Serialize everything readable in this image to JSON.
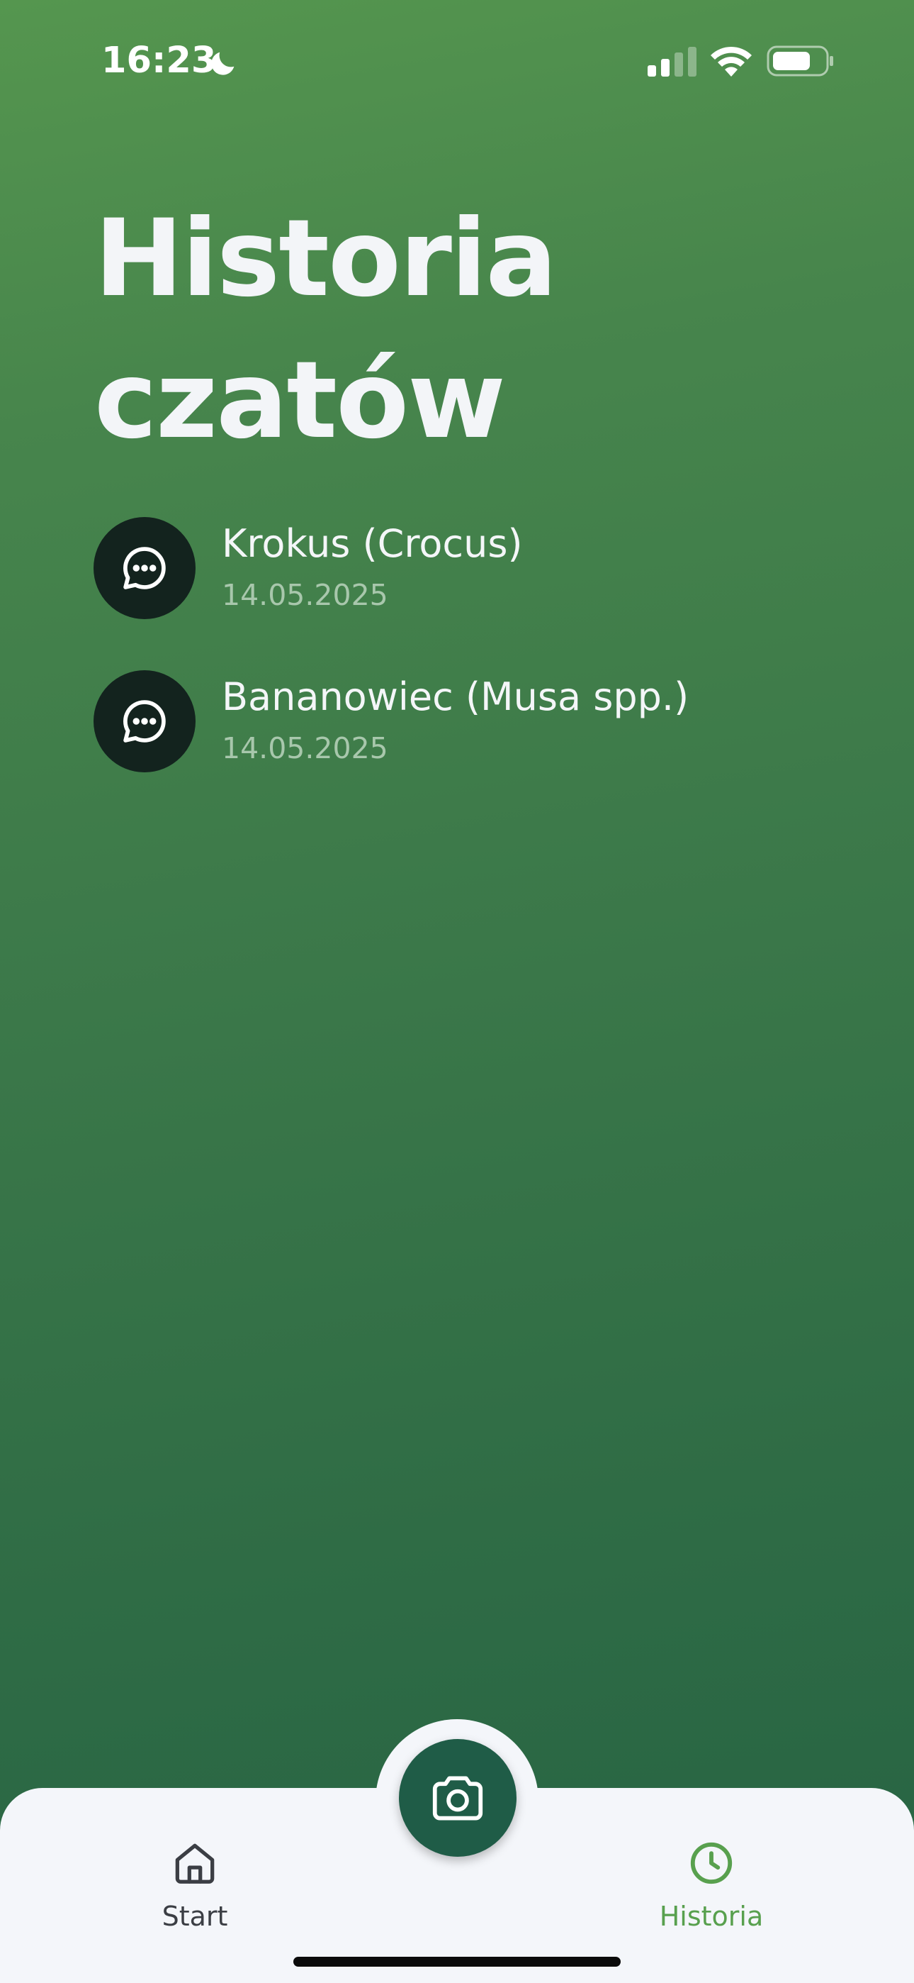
{
  "status_bar": {
    "time": "16:23",
    "icons": [
      "moon-icon",
      "cellular-signal-icon",
      "wifi-icon",
      "battery-icon"
    ]
  },
  "page": {
    "title": "Historia czatów"
  },
  "chats": [
    {
      "title": "Krokus (Crocus)",
      "date": "14.05.2025",
      "icon": "chat-bubble-icon"
    },
    {
      "title": "Bananowiec (Musa spp.)",
      "date": "14.05.2025",
      "icon": "chat-bubble-icon"
    }
  ],
  "tab_bar": {
    "start_label": "Start",
    "history_label": "Historia",
    "camera_icon": "camera-icon",
    "active_tab": "Historia"
  },
  "colors": {
    "background_top": "#55964f",
    "background_bottom": "#266344",
    "avatar_bg": "#13231e",
    "accent_active": "#58a04e",
    "camera_button": "#1f5c47",
    "tab_bar_bg": "#f4f6fa"
  }
}
